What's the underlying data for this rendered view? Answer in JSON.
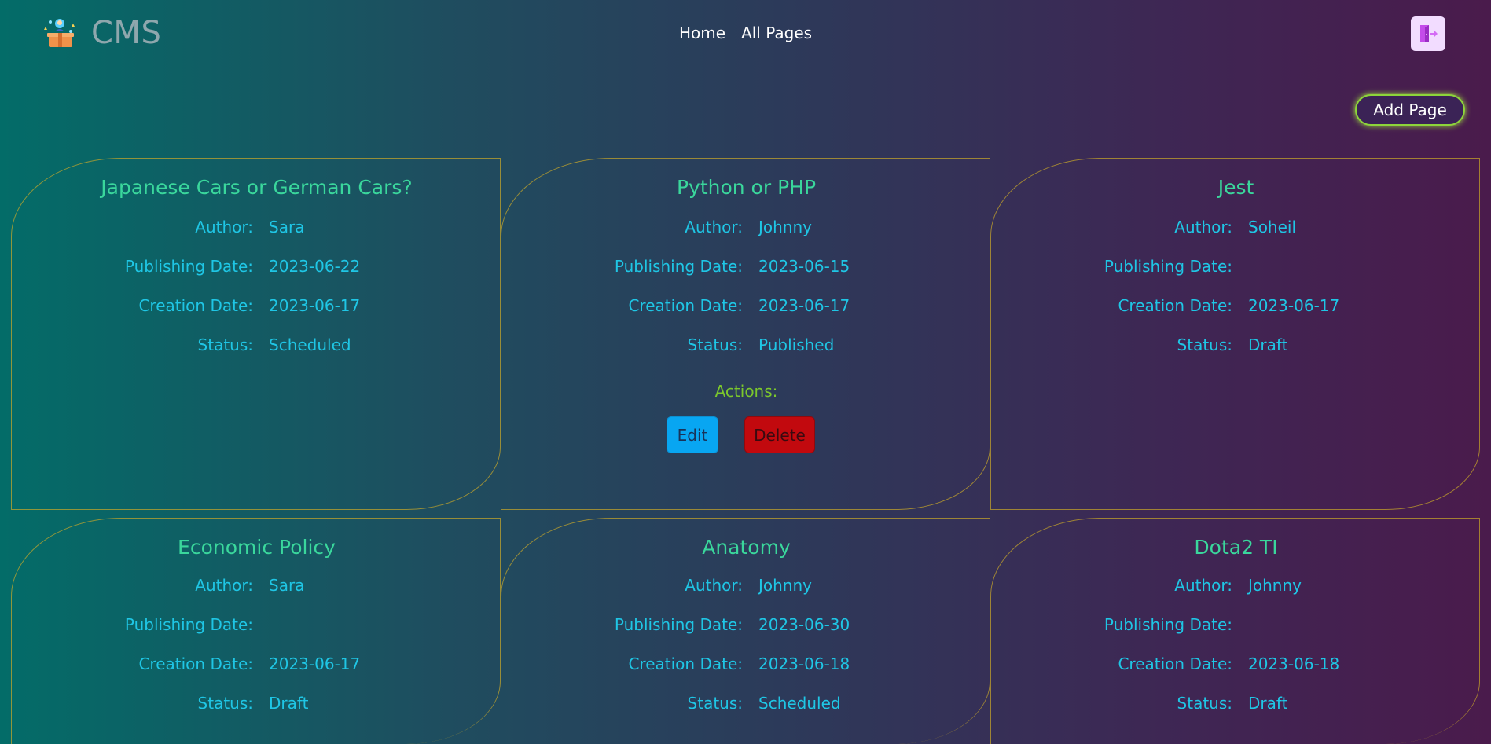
{
  "app": {
    "name": "CMS",
    "logo_icon": "cms-logo-icon"
  },
  "nav": {
    "home": "Home",
    "all_pages": "All Pages"
  },
  "header": {
    "logout_icon": "logout-icon"
  },
  "toolbar": {
    "add_page": "Add Page"
  },
  "labels": {
    "author": "Author:",
    "publishing_date": "Publishing Date:",
    "creation_date": "Creation Date:",
    "status": "Status:",
    "actions": "Actions:",
    "edit": "Edit",
    "delete": "Delete"
  },
  "pages": [
    {
      "title": "Japanese Cars or German Cars?",
      "author": "Sara",
      "publishing_date": "2023-06-22",
      "creation_date": "2023-06-17",
      "status": "Scheduled"
    },
    {
      "title": "Python or PHP",
      "author": "Johnny",
      "publishing_date": "2023-06-15",
      "creation_date": "2023-06-17",
      "status": "Published"
    },
    {
      "title": "Jest",
      "author": "Soheil",
      "publishing_date": "",
      "creation_date": "2023-06-17",
      "status": "Draft"
    },
    {
      "title": "Economic Policy",
      "author": "Sara",
      "publishing_date": "",
      "creation_date": "2023-06-17",
      "status": "Draft"
    },
    {
      "title": "Anatomy",
      "author": "Johnny",
      "publishing_date": "2023-06-30",
      "creation_date": "2023-06-18",
      "status": "Scheduled"
    },
    {
      "title": "Dota2 TI",
      "author": "Johnny",
      "publishing_date": "",
      "creation_date": "2023-06-18",
      "status": "Draft"
    }
  ],
  "colors": {
    "title": "#3ad79c",
    "text": "#1fc6e5",
    "actions": "#7cc82c",
    "edit": "#08a6f2",
    "delete": "#c2090e",
    "add_border": "#8dd53a"
  }
}
